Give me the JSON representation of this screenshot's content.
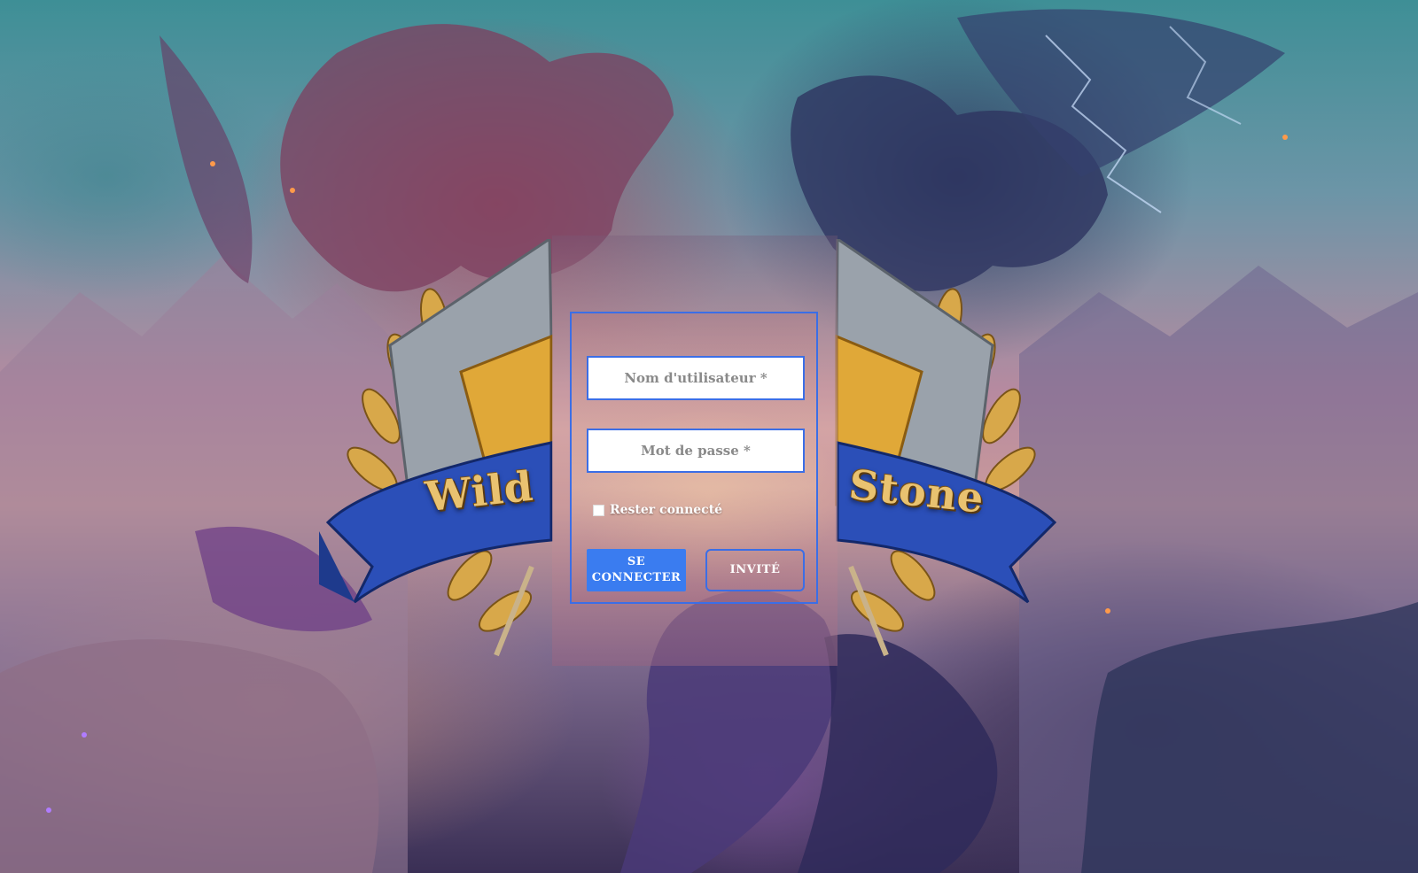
{
  "brand": {
    "left_word": "Wild",
    "right_word": "Stone"
  },
  "login": {
    "username_placeholder": "Nom d'utilisateur *",
    "password_placeholder": "Mot de passe *",
    "remember_label": "Rester connecté",
    "login_button": "Se connecter",
    "guest_button": "Invité"
  },
  "colors": {
    "accent": "#3a7cf0",
    "border": "#3b6ee6",
    "banner_text": "#e9c270",
    "banner_ribbon": "#2b4fb8"
  }
}
